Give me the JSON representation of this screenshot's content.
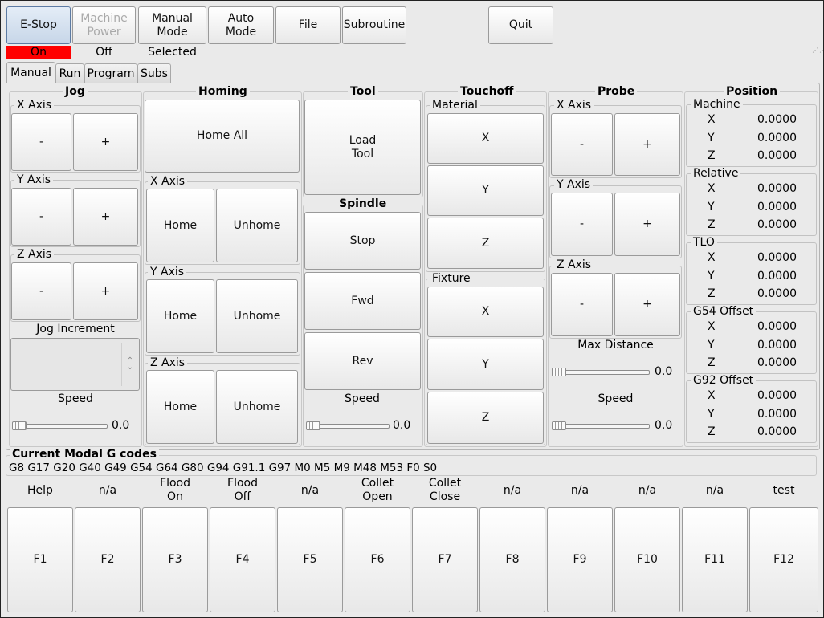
{
  "toolbar": {
    "estop": "E-Stop",
    "machine_power": "Machine\nPower",
    "manual_mode": "Manual\nMode",
    "auto_mode": "Auto\nMode",
    "file": "File",
    "subroutine": "Subroutine",
    "quit": "Quit"
  },
  "status": {
    "estop_state": "On",
    "power_state": "Off",
    "mode_state": "Selected"
  },
  "colors": {
    "estop_on": "#ff0000",
    "accent": "#5d7ba3"
  },
  "tabs": [
    "Manual",
    "Run",
    "Program",
    "Subs"
  ],
  "jog": {
    "title": "Jog",
    "x_axis": "X Axis",
    "y_axis": "Y Axis",
    "z_axis": "Z Axis",
    "minus": "-",
    "plus": "+",
    "increment_label": "Jog Increment",
    "speed_label": "Speed",
    "speed_value": "0.0"
  },
  "homing": {
    "title": "Homing",
    "home_all": "Home All",
    "x_axis": "X Axis",
    "y_axis": "Y Axis",
    "z_axis": "Z Axis",
    "home": "Home",
    "unhome": "Unhome"
  },
  "tool": {
    "title": "Tool",
    "load_tool": "Load\nTool"
  },
  "spindle": {
    "title": "Spindle",
    "stop": "Stop",
    "fwd": "Fwd",
    "rev": "Rev",
    "speed_label": "Speed",
    "speed_value": "0.0"
  },
  "touchoff": {
    "title": "Touchoff",
    "material": "Material",
    "fixture": "Fixture",
    "x": "X",
    "y": "Y",
    "z": "Z"
  },
  "probe": {
    "title": "Probe",
    "x_axis": "X Axis",
    "y_axis": "Y Axis",
    "z_axis": "Z Axis",
    "minus": "-",
    "plus": "+",
    "max_distance_label": "Max Distance",
    "max_distance_value": "0.0",
    "speed_label": "Speed",
    "speed_value": "0.0"
  },
  "position": {
    "title": "Position",
    "groups": [
      {
        "name": "Machine",
        "x": "0.0000",
        "y": "0.0000",
        "z": "0.0000"
      },
      {
        "name": "Relative",
        "x": "0.0000",
        "y": "0.0000",
        "z": "0.0000"
      },
      {
        "name": "TLO",
        "x": "0.0000",
        "y": "0.0000",
        "z": "0.0000"
      },
      {
        "name": "G54 Offset",
        "x": "0.0000",
        "y": "0.0000",
        "z": "0.0000"
      },
      {
        "name": "G92 Offset",
        "x": "0.0000",
        "y": "0.0000",
        "z": "0.0000"
      }
    ],
    "axis_x": "X",
    "axis_y": "Y",
    "axis_z": "Z"
  },
  "modal": {
    "title": "Current Modal G codes",
    "codes": "G8 G17 G20 G40 G49 G54 G64 G80 G94 G91.1 G97 M0 M5 M9 M48 M53 F0 S0"
  },
  "fkeys": {
    "labels": [
      "Help",
      "n/a",
      "Flood\nOn",
      "Flood\nOff",
      "n/a",
      "Collet\nOpen",
      "Collet\nClose",
      "n/a",
      "n/a",
      "n/a",
      "n/a",
      "test"
    ],
    "buttons": [
      "F1",
      "F2",
      "F3",
      "F4",
      "F5",
      "F6",
      "F7",
      "F8",
      "F9",
      "F10",
      "F11",
      "F12"
    ]
  }
}
